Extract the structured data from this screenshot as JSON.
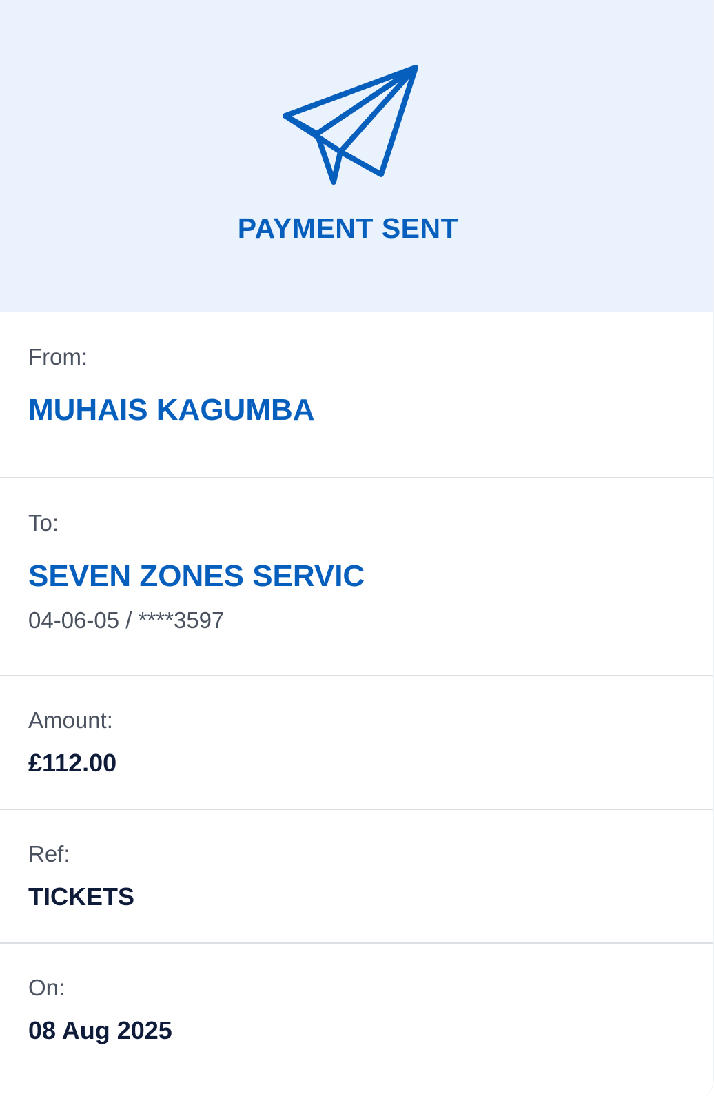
{
  "colors": {
    "accent": "#075fbd",
    "hero_bg": "#eaf3fd",
    "label": "#4a5260",
    "value": "#0e1c3a",
    "divider": "#dcdfe4"
  },
  "header": {
    "icon": "paper-plane-icon",
    "title": "PAYMENT SENT"
  },
  "details": {
    "from": {
      "label": "From:",
      "name": "MUHAIS KAGUMBA"
    },
    "to": {
      "label": "To:",
      "name": "SEVEN ZONES SERVIC",
      "account": "04-06-05 / ****3597"
    },
    "amount": {
      "label": "Amount:",
      "value": "£112.00"
    },
    "reference": {
      "label": "Ref:",
      "value": "TICKETS"
    },
    "date": {
      "label": "On:",
      "value": "08 Aug 2025"
    }
  }
}
